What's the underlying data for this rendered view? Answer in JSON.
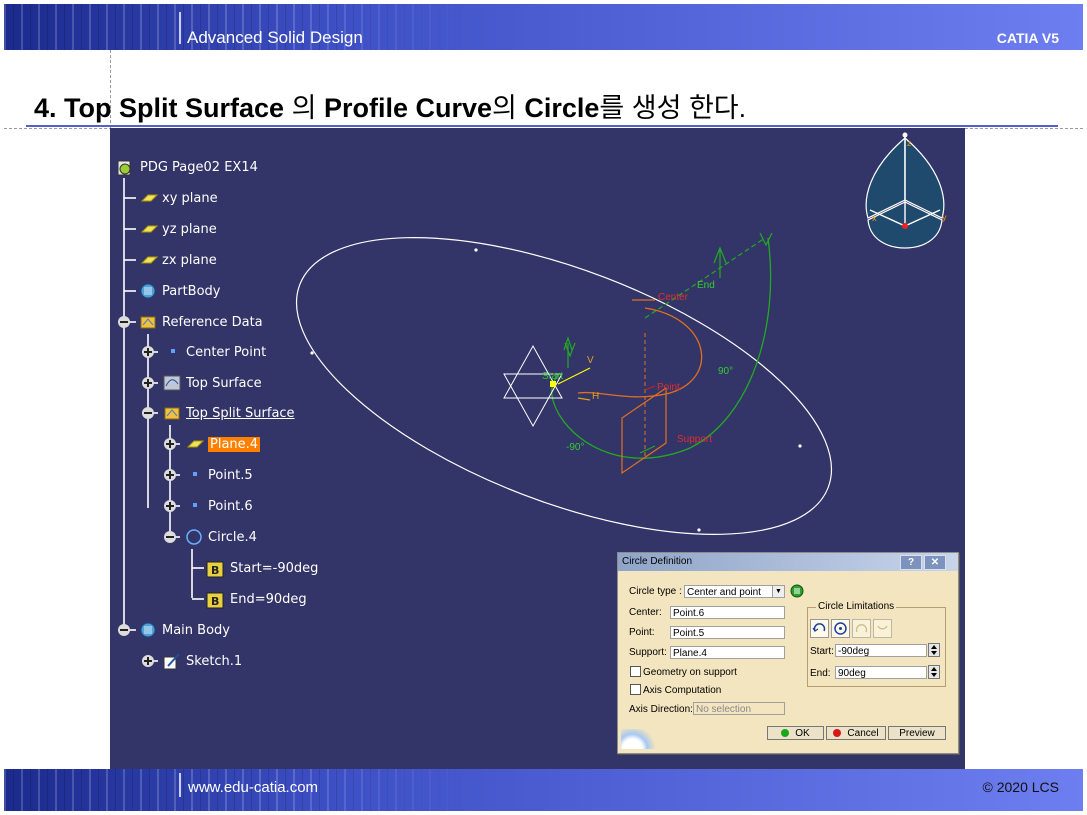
{
  "header": {
    "left_text": "Advanced Solid Design",
    "right_text": "CATIA V5"
  },
  "slide": {
    "num": "4.",
    "t1": "Top Split Surface",
    "t2": "의",
    "t3": "Profile Curve",
    "t4": "의",
    "t5": "Circle",
    "t6": "를 생성 한다."
  },
  "footer": {
    "left_text": "www.edu-catia.com",
    "right_text": "© 2020 LCS"
  },
  "tree": {
    "root": "PDG Page02 EX14",
    "items": [
      {
        "label": "xy plane",
        "icon": "plane-icon"
      },
      {
        "label": "yz plane",
        "icon": "plane-icon"
      },
      {
        "label": "zx plane",
        "icon": "plane-icon"
      },
      {
        "label": "PartBody",
        "icon": "partbody-icon"
      },
      {
        "label": "Reference Data",
        "icon": "geometrical-set-icon"
      },
      {
        "label": "Center Point",
        "icon": "point-icon"
      },
      {
        "label": "Top Surface",
        "icon": "surface-icon"
      },
      {
        "label": "Top Split Surface",
        "icon": "geometrical-set-icon"
      },
      {
        "label": "Plane.4",
        "icon": "plane-icon"
      },
      {
        "label": "Point.5",
        "icon": "point-icon"
      },
      {
        "label": "Point.6",
        "icon": "point-icon"
      },
      {
        "label": "Circle.4",
        "icon": "circle-icon"
      },
      {
        "label": "Start=-90deg",
        "icon": "parameter-icon"
      },
      {
        "label": "End=90deg",
        "icon": "parameter-icon"
      },
      {
        "label": "Main Body",
        "icon": "body-icon"
      },
      {
        "label": "Sketch.1",
        "icon": "sketch-icon"
      }
    ]
  },
  "viewport_labels": {
    "center": "Center",
    "end": "End",
    "start": "Start",
    "point": "Point",
    "support": "Support",
    "h": "H",
    "v": "V",
    "angle_pos": "90°",
    "angle_neg": "-90°"
  },
  "compass": {
    "x": "x",
    "y": "y",
    "z": "z"
  },
  "dialog": {
    "title": "Circle Definition",
    "help": "?",
    "close": "✕",
    "circle_type_label": "Circle type :",
    "circle_type_value": "Center and point",
    "center_label": "Center:",
    "center_value": "Point.6",
    "point_label": "Point:",
    "point_value": "Point.5",
    "support_label": "Support:",
    "support_value": "Plane.4",
    "geometry_on_support": "Geometry on support",
    "axis_computation": "Axis Computation",
    "axis_direction_label": "Axis Direction:",
    "axis_direction_value": "No selection",
    "limitations_title": "Circle Limitations",
    "start_label": "Start:",
    "start_value": "-90deg",
    "end_label": "End:",
    "end_value": "90deg",
    "ok": "OK",
    "cancel": "Cancel",
    "preview": "Preview",
    "ok_color": "#1aa81a",
    "cancel_color": "#d81818"
  }
}
